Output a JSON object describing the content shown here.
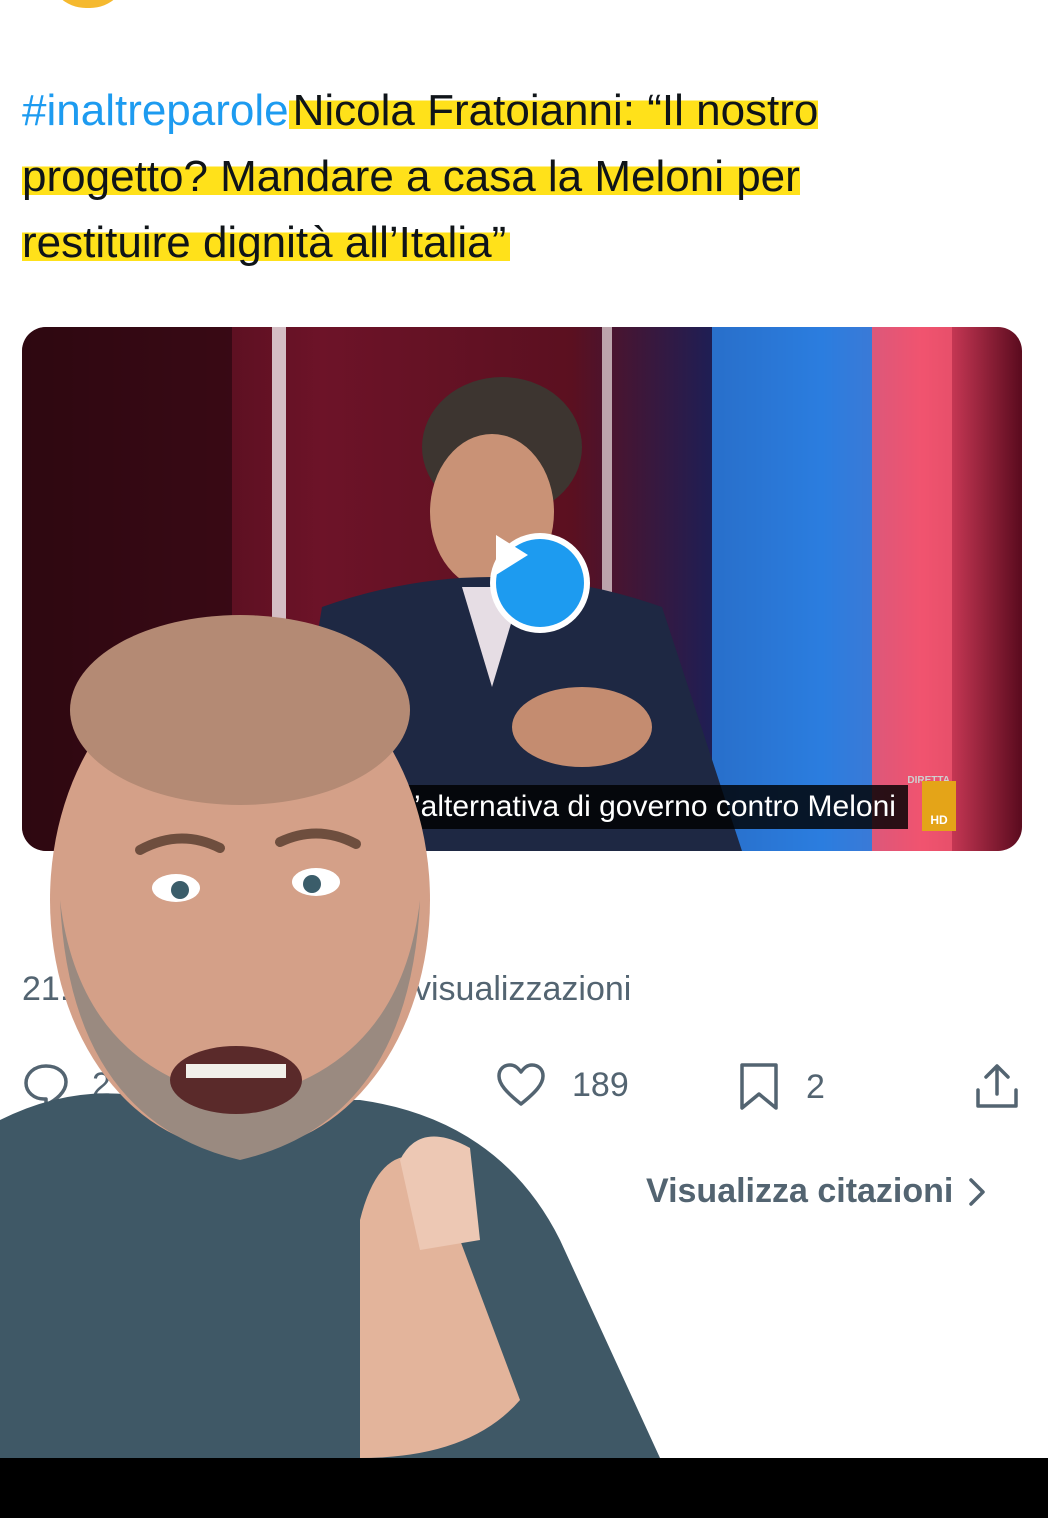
{
  "tweet": {
    "hashtag": "#inaltreparole",
    "text": "Nicola Fratoianni: “Il nostro progetto? Mandare a casa la Meloni per restituire dignità all’Italia”"
  },
  "video": {
    "subtitle": "’alternativa di governo contro Meloni",
    "channel_badge": "HD",
    "channel_label": "DIRETTA"
  },
  "meta": {
    "time": "21:1",
    "views_label": "visualizzazioni"
  },
  "actions": {
    "replies": "2",
    "likes": "189",
    "bookmarks": "2"
  },
  "quotes_link": "Visualizza citazioni",
  "colors": {
    "accent": "#1d9bf0",
    "highlight": "#ffe11a",
    "muted_text": "#536471"
  },
  "icons": [
    "reply-icon",
    "heart-icon",
    "bookmark-icon",
    "share-icon",
    "play-icon",
    "chevron-right-icon"
  ]
}
